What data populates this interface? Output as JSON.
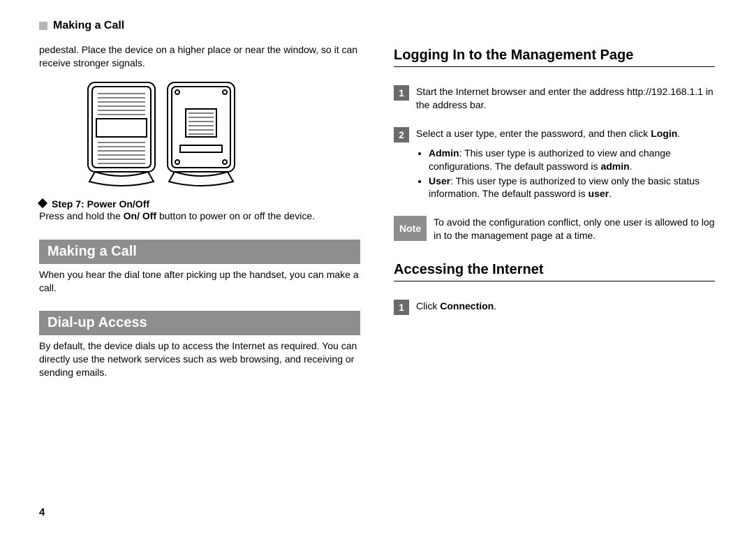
{
  "running_head": "Making a Call",
  "left": {
    "pedestal_text": "pedestal. Place the device on a higher place or near the window, so it can receive stronger signals.",
    "step7_label": "Step 7: Power On/Off",
    "step7_text_a": "Press and hold the ",
    "step7_text_bold": "On/ Off",
    "step7_text_b": " button to power on or off the device.",
    "section_making_call": "Making a Call",
    "making_call_text": "When you hear the dial tone after picking up the handset, you can make a call.",
    "section_dialup": "Dial-up Access",
    "dialup_text": "By default, the device dials up to access the Internet as required. You can directly use the network services such as web browsing, and receiving or sending emails."
  },
  "right": {
    "subhead_login": "Logging In to the Management Page",
    "step1_num": "1",
    "step1_text": "Start the Internet browser and enter the address http://192.168.1.1 in the address bar.",
    "step2_num": "2",
    "step2_text_a": "Select a user type, enter the password, and then click ",
    "step2_text_bold": "Login",
    "step2_text_b": ".",
    "bullet_admin_label": "Admin",
    "bullet_admin_text_a": ": This user type is authorized to view and change configurations. The default password is ",
    "bullet_admin_text_bold": "admin",
    "bullet_admin_text_b": ".",
    "bullet_user_label": "User",
    "bullet_user_text_a": ": This user type is authorized to view only the basic status information. The default password is ",
    "bullet_user_text_bold": "user",
    "bullet_user_text_b": ".",
    "note_label": "Note",
    "note_text": "To avoid the configuration conflict, only one user is allowed to log in to the management page at a time.",
    "subhead_accessing": "Accessing the Internet",
    "access_step1_num": "1",
    "access_step1_text_a": "Click ",
    "access_step1_text_bold": "Connection",
    "access_step1_text_b": "."
  },
  "page_number": "4"
}
